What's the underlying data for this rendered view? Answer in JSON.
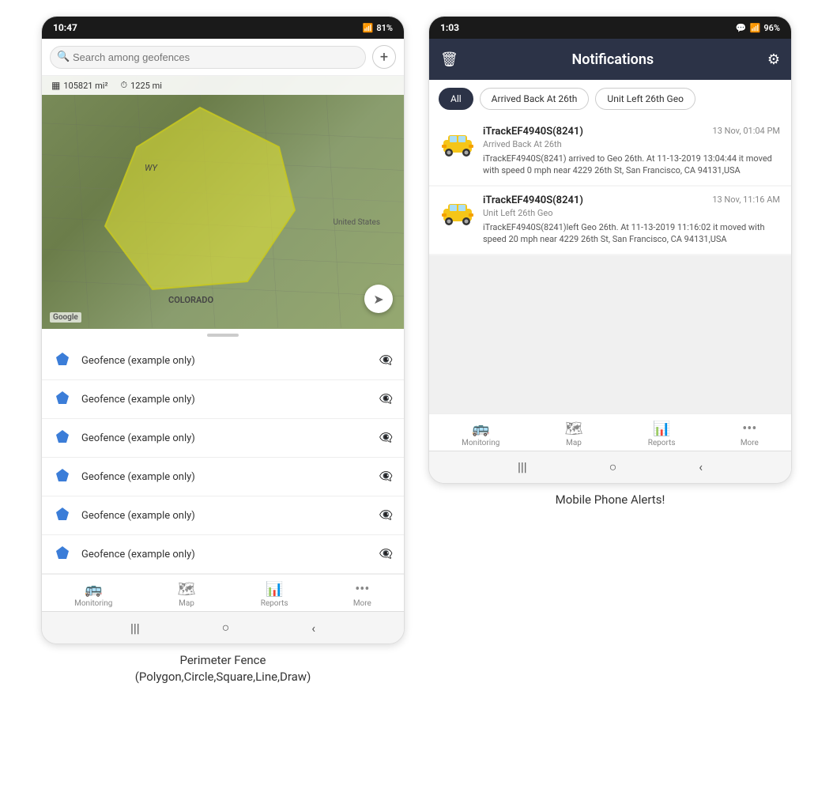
{
  "left_phone": {
    "status_bar": {
      "time": "10:47",
      "battery": "81%",
      "signal": "📶"
    },
    "search": {
      "placeholder": "Search among geofences"
    },
    "map": {
      "stats": [
        {
          "icon": "⊞",
          "value": "105821 mi²"
        },
        {
          "icon": "⏱",
          "value": "1225 mi"
        }
      ],
      "labels": {
        "wy": "WY",
        "colorado": "COLORADO",
        "united_states": "United States"
      }
    },
    "geofences": [
      {
        "name": "Geofence (example only)"
      },
      {
        "name": "Geofence (example only)"
      },
      {
        "name": "Geofence (example only)"
      },
      {
        "name": "Geofence (example only)"
      },
      {
        "name": "Geofence (example only)"
      },
      {
        "name": "Geofence (example only)"
      }
    ],
    "bottom_nav": [
      {
        "label": "Monitoring",
        "icon": "🚌"
      },
      {
        "label": "Map",
        "icon": "🗺"
      },
      {
        "label": "Reports",
        "icon": "📊"
      },
      {
        "label": "More",
        "icon": "···"
      }
    ],
    "caption": "Perimeter Fence\n(Polygon,Circle,Square,Line,Draw)"
  },
  "right_phone": {
    "status_bar": {
      "time": "1:03",
      "battery": "96%"
    },
    "header": {
      "title": "Notifications"
    },
    "filter_tabs": [
      {
        "label": "All",
        "active": true
      },
      {
        "label": "Arrived Back At 26th",
        "active": false
      },
      {
        "label": "Unit Left 26th Geo",
        "active": false
      }
    ],
    "notifications": [
      {
        "device": "iTrackEF4940S(8241)",
        "time": "13 Nov, 01:04 PM",
        "event": "Arrived Back At 26th",
        "body": "iTrackEF4940S(8241) arrived to Geo 26th.    At 11-13-2019 13:04:44 it moved with speed 0 mph near 4229 26th St, San Francisco, CA 94131,USA"
      },
      {
        "device": "iTrackEF4940S(8241)",
        "time": "13 Nov, 11:16 AM",
        "event": "Unit Left 26th Geo",
        "body": "iTrackEF4940S(8241)left Geo 26th.   At 11-13-2019 11:16:02 it moved with speed 20 mph near 4229 26th St, San Francisco, CA 94131,USA"
      }
    ],
    "bottom_nav": [
      {
        "label": "Monitoring",
        "icon": "🚌"
      },
      {
        "label": "Map",
        "icon": "🗺"
      },
      {
        "label": "Reports",
        "icon": "📊"
      },
      {
        "label": "More",
        "icon": "···"
      }
    ],
    "caption": "Mobile Phone Alerts!"
  }
}
